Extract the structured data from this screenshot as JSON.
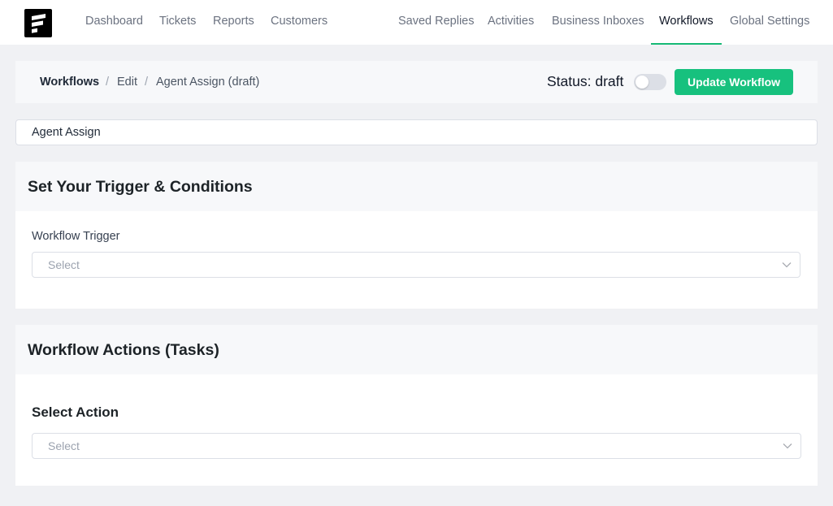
{
  "nav": {
    "left_items": [
      "Dashboard",
      "Tickets",
      "Reports",
      "Customers"
    ],
    "right_items": [
      "Saved Replies",
      "Activities",
      "Business Inboxes",
      "Workflows",
      "Global Settings"
    ],
    "active": "Workflows",
    "accent_color": "#16b976"
  },
  "breadcrumb": {
    "root": "Workflows",
    "edit": "Edit",
    "current": "Agent Assign (draft)",
    "separator": "/"
  },
  "status": {
    "label": "Status: draft",
    "toggle_on": false
  },
  "update_button": "Update Workflow",
  "workflow_name": "Agent Assign",
  "trigger_section": {
    "title": "Set Your Trigger & Conditions",
    "trigger_label": "Workflow Trigger",
    "trigger_placeholder": "Select"
  },
  "actions_section": {
    "title": "Workflow Actions (Tasks)",
    "action_label": "Select Action",
    "action_placeholder": "Select"
  },
  "icons": {
    "logo": "brand-logo-icon",
    "select_arrow": "chevron-down-icon"
  },
  "colors": {
    "primary_button": "#17c17e",
    "page_background": "#f0f1f4"
  }
}
